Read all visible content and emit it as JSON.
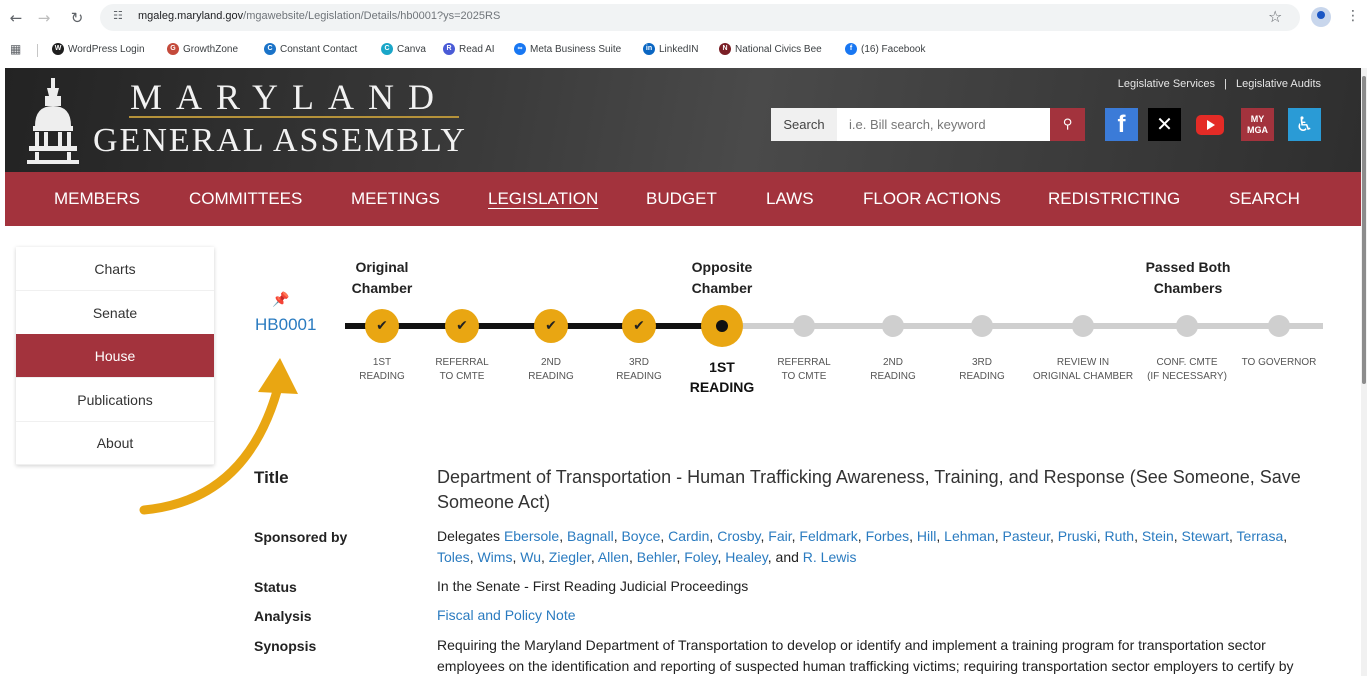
{
  "browser": {
    "url_host": "mgaleg.maryland.gov",
    "url_path": "/mgawebsite/Legislation/Details/hb0001?ys=2025RS",
    "bookmarks": [
      {
        "label": "WordPress Login",
        "color": "#1e1e1e",
        "glyph": "W"
      },
      {
        "label": "GrowthZone",
        "color": "#c44a3b",
        "glyph": "G"
      },
      {
        "label": "Constant Contact",
        "color": "#1a73c8",
        "glyph": "C"
      },
      {
        "label": "Canva",
        "color": "#1aa6c8",
        "glyph": "C"
      },
      {
        "label": "Read AI",
        "color": "#4a5bd6",
        "glyph": "R"
      },
      {
        "label": "Meta Business Suite",
        "color": "#1877f2",
        "glyph": "∞"
      },
      {
        "label": "LinkedIN",
        "color": "#0a66c2",
        "glyph": "in"
      },
      {
        "label": "National Civics Bee",
        "color": "#7a1f26",
        "glyph": "N"
      },
      {
        "label": "(16) Facebook",
        "color": "#1877f2",
        "glyph": "f"
      }
    ]
  },
  "header": {
    "logo_line1": "MARYLAND",
    "logo_line2": "GENERAL ASSEMBLY",
    "link_services": "Legislative Services",
    "link_sep": "|",
    "link_audits": "Legislative Audits",
    "search_label": "Search",
    "search_placeholder": "i.e. Bill search, keyword",
    "search_icon": "magnifier-icon",
    "mymga_line1": "MY",
    "mymga_line2": "MGA",
    "accent": "#a3333d"
  },
  "nav": [
    {
      "label": "MEMBERS",
      "active": false
    },
    {
      "label": "COMMITTEES",
      "active": false
    },
    {
      "label": "MEETINGS",
      "active": false
    },
    {
      "label": "LEGISLATION",
      "active": true
    },
    {
      "label": "BUDGET",
      "active": false
    },
    {
      "label": "LAWS",
      "active": false
    },
    {
      "label": "FLOOR ACTIONS",
      "active": false
    },
    {
      "label": "REDISTRICTING",
      "active": false
    },
    {
      "label": "SEARCH",
      "active": false
    }
  ],
  "sidebar": [
    {
      "label": "Charts",
      "active": false
    },
    {
      "label": "Senate",
      "active": false
    },
    {
      "label": "House",
      "active": true
    },
    {
      "label": "Publications",
      "active": false
    },
    {
      "label": "About",
      "active": false
    }
  ],
  "bill": {
    "id": "HB0001",
    "phases": [
      {
        "line1": "Original",
        "line2": "Chamber"
      },
      {
        "line1": "Opposite",
        "line2": "Chamber"
      },
      {
        "line1": "Passed Both",
        "line2": "Chambers"
      }
    ],
    "steps": [
      {
        "line1": "1ST",
        "line2": "READING",
        "state": "done"
      },
      {
        "line1": "REFERRAL",
        "line2": "TO CMTE",
        "state": "done"
      },
      {
        "line1": "2ND",
        "line2": "READING",
        "state": "done"
      },
      {
        "line1": "3RD",
        "line2": "READING",
        "state": "done"
      },
      {
        "line1": "1ST",
        "line2": "READING",
        "state": "current"
      },
      {
        "line1": "REFERRAL",
        "line2": "TO CMTE",
        "state": "pending"
      },
      {
        "line1": "2ND",
        "line2": "READING",
        "state": "pending"
      },
      {
        "line1": "3RD",
        "line2": "READING",
        "state": "pending"
      },
      {
        "line1": "REVIEW IN",
        "line2": "ORIGINAL CHAMBER",
        "state": "pending"
      },
      {
        "line1": "CONF. CMTE",
        "line2": "(IF NECESSARY)",
        "state": "pending"
      },
      {
        "line1": "TO GOVERNOR",
        "line2": "",
        "state": "pending"
      }
    ]
  },
  "details": {
    "title_label": "Title",
    "title_value": "Department of Transportation - Human Trafficking Awareness, Training, and Response (See Someone, Save Someone Act)",
    "sponsor_label": "Sponsored by",
    "sponsor_prefix": "Delegates",
    "sponsors": [
      "Ebersole",
      "Bagnall",
      "Boyce",
      "Cardin",
      "Crosby",
      "Fair",
      "Feldmark",
      "Forbes",
      "Hill",
      "Lehman",
      "Pasteur",
      "Pruski",
      "Ruth",
      "Stein",
      "Stewart",
      "Terrasa",
      "Toles",
      "Wims",
      "Wu",
      "Ziegler",
      "Allen",
      "Behler",
      "Foley",
      "Healey"
    ],
    "sponsor_and": "and",
    "sponsor_last": "R. Lewis",
    "status_label": "Status",
    "status_value": "In the Senate - First Reading Judicial Proceedings",
    "analysis_label": "Analysis",
    "analysis_value": "Fiscal and Policy Note",
    "synopsis_label": "Synopsis",
    "synopsis_value": "Requiring the Maryland Department of Transportation to develop or identify and implement a training program for transportation sector employees on the identification and reporting of suspected human trafficking victims; requiring transportation sector employers to certify by"
  }
}
